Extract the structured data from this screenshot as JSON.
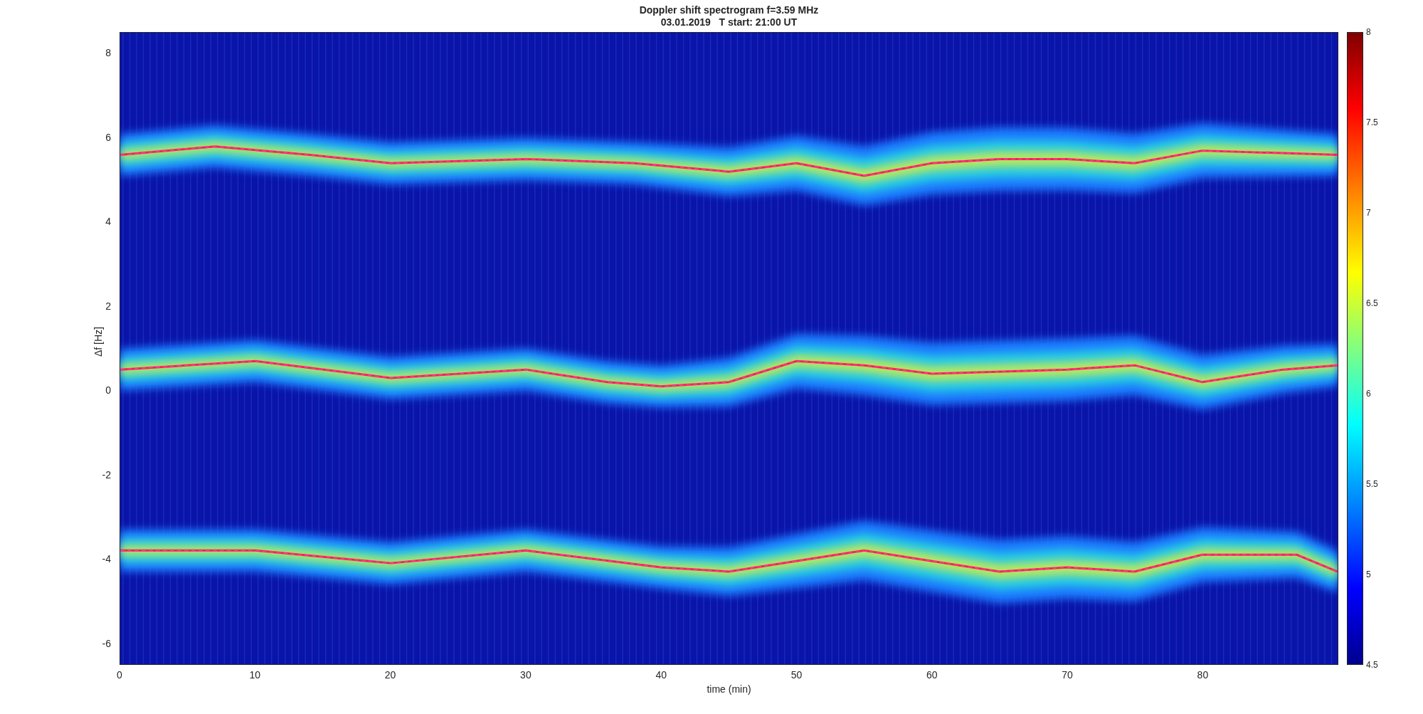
{
  "figure": {
    "title": "Doppler shift spectrogram f=3.59 MHz",
    "subtitle": "03.01.2019   T start: 21:00 UT"
  },
  "axes": {
    "xlabel": "time (min)",
    "ylabel": "Δf [Hz]",
    "xticks": [
      "0",
      "10",
      "20",
      "30",
      "40",
      "50",
      "60",
      "70",
      "80"
    ],
    "yticks": [
      "8",
      "6",
      "4",
      "2",
      "0",
      "-2",
      "-4",
      "-6"
    ]
  },
  "colorbar": {
    "ticks": [
      "8",
      "7.5",
      "7",
      "6.5",
      "6",
      "5.5",
      "5",
      "4.5"
    ]
  }
}
